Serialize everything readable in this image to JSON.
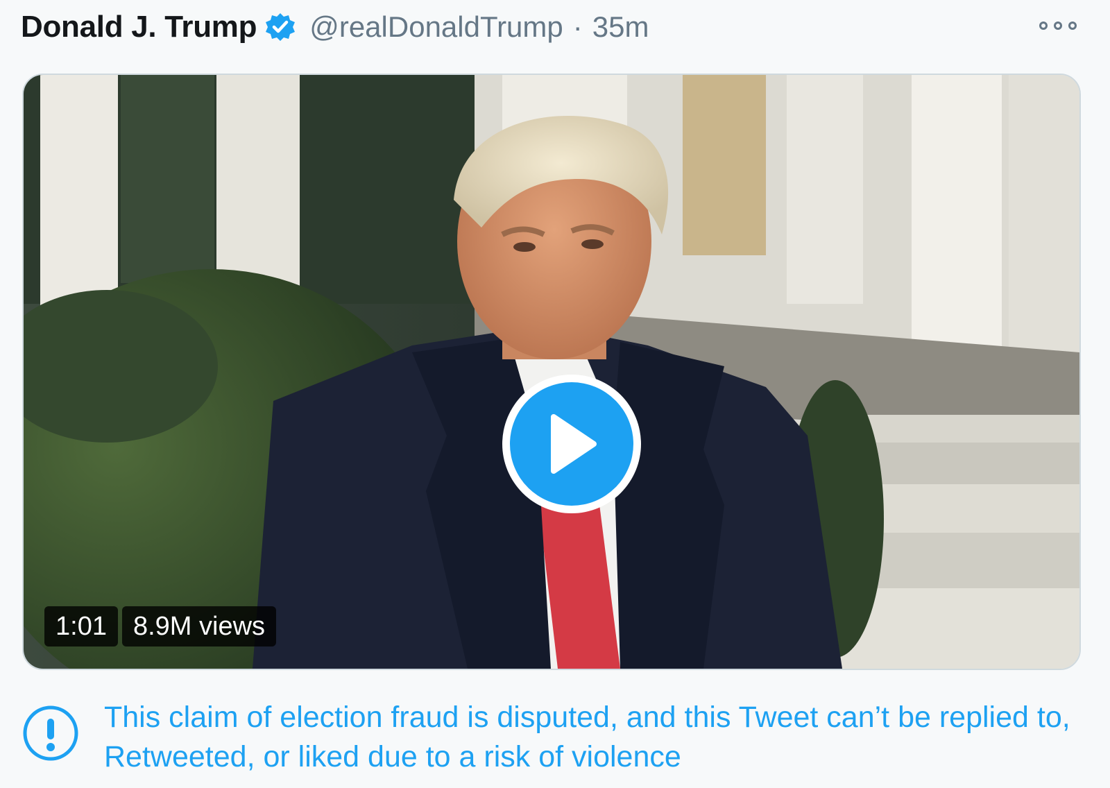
{
  "tweet": {
    "display_name": "Donald J. Trump",
    "verified_icon": "verified-badge-icon",
    "handle": "@realDonaldTrump",
    "separator": "·",
    "timestamp": "35m",
    "more_icon": "more-options-icon"
  },
  "media": {
    "type": "video",
    "duration": "1:01",
    "views": "8.9M views",
    "play_icon": "play-icon"
  },
  "notice": {
    "icon": "exclamation-circle-icon",
    "text": "This claim of election fraud is disputed, and this Tweet can’t be replied to, Retweeted, or liked due to a risk of violence"
  },
  "colors": {
    "accent": "#1da1f2",
    "secondary_text": "#657786",
    "primary_text": "#14171a",
    "background": "#f7f9fa"
  }
}
